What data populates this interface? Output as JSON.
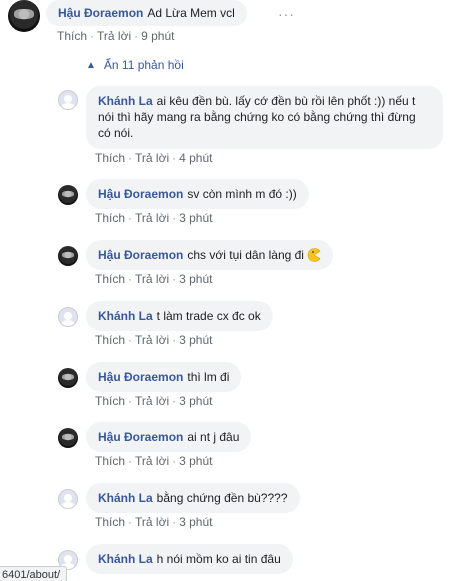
{
  "top_comment": {
    "author": "Hậu Đoraemon",
    "text": "Ad Lừa Mem vcl",
    "like": "Thích",
    "reply": "Trả lời",
    "time": "9 phút",
    "more": "···"
  },
  "replies_toggle": {
    "label": "Ẩn 11 phản hồi"
  },
  "replies": [
    {
      "author": "Khánh La",
      "text": "ai kêu đền bù. lấy cớ đền bù rồi lên phốt :)) nếu t nói thì hãy mang ra bằng chứng ko có bằng chứng thì đừng có nói.",
      "like": "Thích",
      "reply": "Trả lời",
      "time": "4 phút"
    },
    {
      "author": "Hậu Đoraemon",
      "text": "sv còn mình m đó :))",
      "like": "Thích",
      "reply": "Trả lời",
      "time": "3 phút"
    },
    {
      "author": "Hậu Đoraemon",
      "text": "chs với tụi dân làng đi",
      "like": "Thích",
      "reply": "Trả lời",
      "time": "3 phút"
    },
    {
      "author": "Khánh La",
      "text": "t làm trade cx đc ok",
      "like": "Thích",
      "reply": "Trả lời",
      "time": "3 phút"
    },
    {
      "author": "Hậu Đoraemon",
      "text": "thì lm đi",
      "like": "Thích",
      "reply": "Trả lời",
      "time": "3 phút"
    },
    {
      "author": "Hậu Đoraemon",
      "text": "ai nt j đâu",
      "like": "Thích",
      "reply": "Trả lời",
      "time": "3 phút"
    },
    {
      "author": "Khánh La",
      "text": "bằng chứng đền bù????",
      "like": "Thích",
      "reply": "Trả lời",
      "time": "3 phút"
    },
    {
      "author": "Khánh La",
      "text": "h nói mồm ko ai tin đâu",
      "like": "Thích",
      "reply": "Trả lời",
      "time": ""
    }
  ],
  "status_bar": {
    "url": "6401/about/"
  },
  "colors": {
    "author_link": "#385898",
    "bubble_bg": "#f2f3f5",
    "meta_text": "#606770"
  },
  "icons": {
    "emoji": "pacman-emoji-icon",
    "chevron": "chevron-up-icon"
  }
}
